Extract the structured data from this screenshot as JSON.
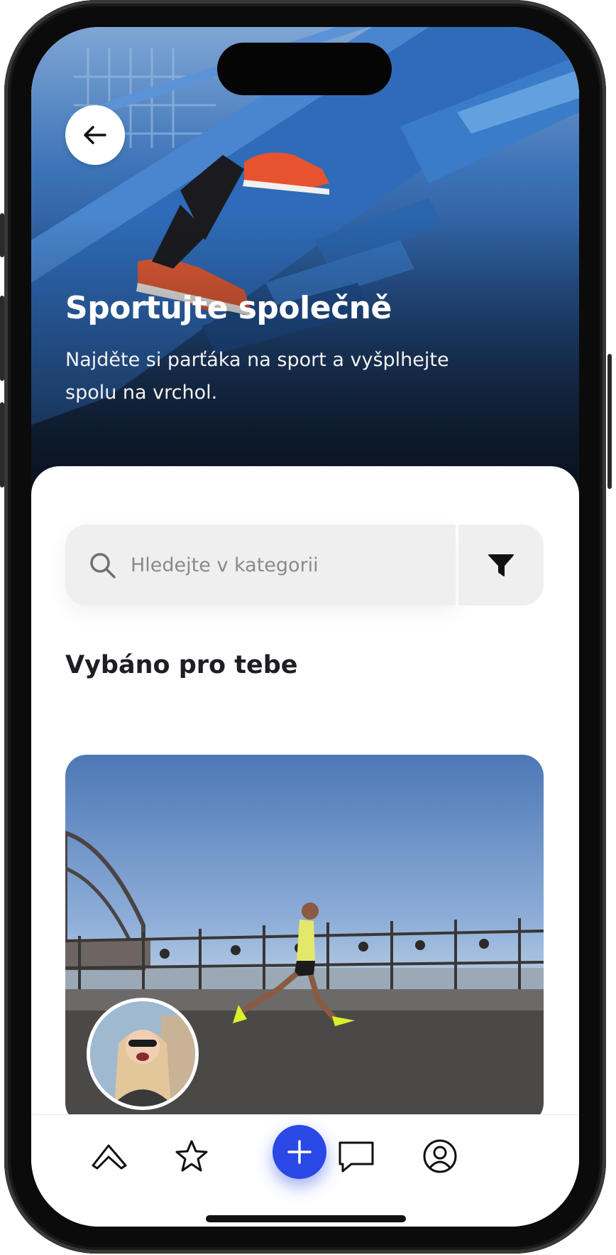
{
  "hero": {
    "title": "Sportujte společně",
    "subtitle": "Najděte si parťáka na sport a vyšplhejte spolu na vrchol.",
    "image": "runner climbing blue stairs"
  },
  "search": {
    "placeholder": "Hledejte v kategorii"
  },
  "section": {
    "title": "Vybáno pro tebe"
  },
  "card": {
    "image": "man running by harbour bridge",
    "avatar": "smiling woman portrait"
  },
  "icons": {
    "back": "arrow-left-icon",
    "search": "search-icon",
    "filter": "filter-icon",
    "tabs": [
      "home-icon",
      "star-icon",
      "plus-icon",
      "chat-icon",
      "profile-icon"
    ]
  },
  "colors": {
    "accent": "#2a48e6",
    "text_dark": "#1e1e24",
    "search_bg": "#efefef"
  }
}
